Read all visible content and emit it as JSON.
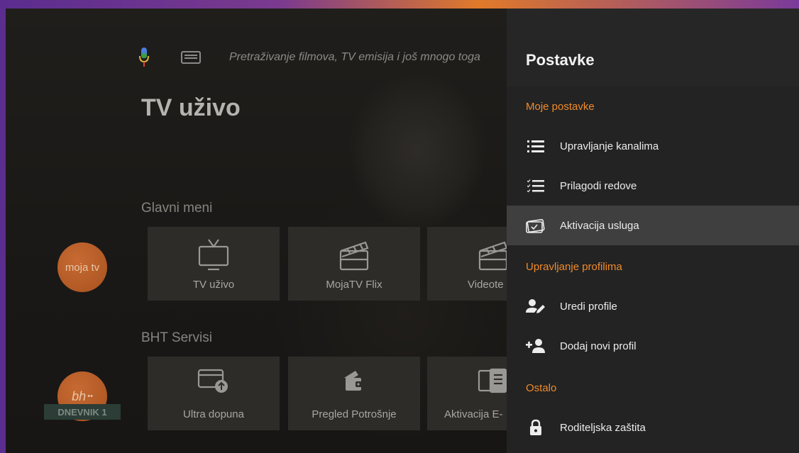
{
  "search": {
    "placeholder": "Pretraživanje filmova, TV emisija i još mnogo toga"
  },
  "page": {
    "title": "TV uživo"
  },
  "main_menu": {
    "label": "Glavni meni",
    "tiles": [
      {
        "label": "TV uživo",
        "icon": "tv-icon"
      },
      {
        "label": "MojaTV Flix",
        "icon": "clapperboard-icon"
      },
      {
        "label": "Videote",
        "icon": "clapperboard-icon"
      }
    ]
  },
  "services": {
    "label": "BHT Servisi",
    "tiles": [
      {
        "label": "Ultra dopuna",
        "icon": "card-upload-icon"
      },
      {
        "label": "Pregled Potrošnje",
        "icon": "wallet-icon"
      },
      {
        "label": "Aktivacija E-",
        "icon": "document-icon"
      }
    ]
  },
  "logos": {
    "moja_tv": "moja tv",
    "bh": "bh"
  },
  "ticker": {
    "text": "DNEVNIK 1"
  },
  "settings": {
    "title": "Postavke",
    "groups": [
      {
        "label": "Moje postavke"
      },
      {
        "label": "Upravljanje profilima"
      },
      {
        "label": "Ostalo"
      }
    ],
    "items": [
      {
        "label": "Upravljanje kanalima",
        "icon": "list-icon"
      },
      {
        "label": "Prilagodi redove",
        "icon": "checklist-icon"
      },
      {
        "label": "Aktivacija usluga",
        "icon": "ticket-check-icon",
        "selected": true
      },
      {
        "label": "Uredi profile",
        "icon": "user-edit-icon"
      },
      {
        "label": "Dodaj novi profil",
        "icon": "user-add-icon"
      },
      {
        "label": "Roditeljska zaštita",
        "icon": "lock-icon"
      }
    ]
  },
  "colors": {
    "accent": "#f08a2c",
    "panel_bg": "#232323",
    "selected_bg": "#3f3f3f"
  }
}
